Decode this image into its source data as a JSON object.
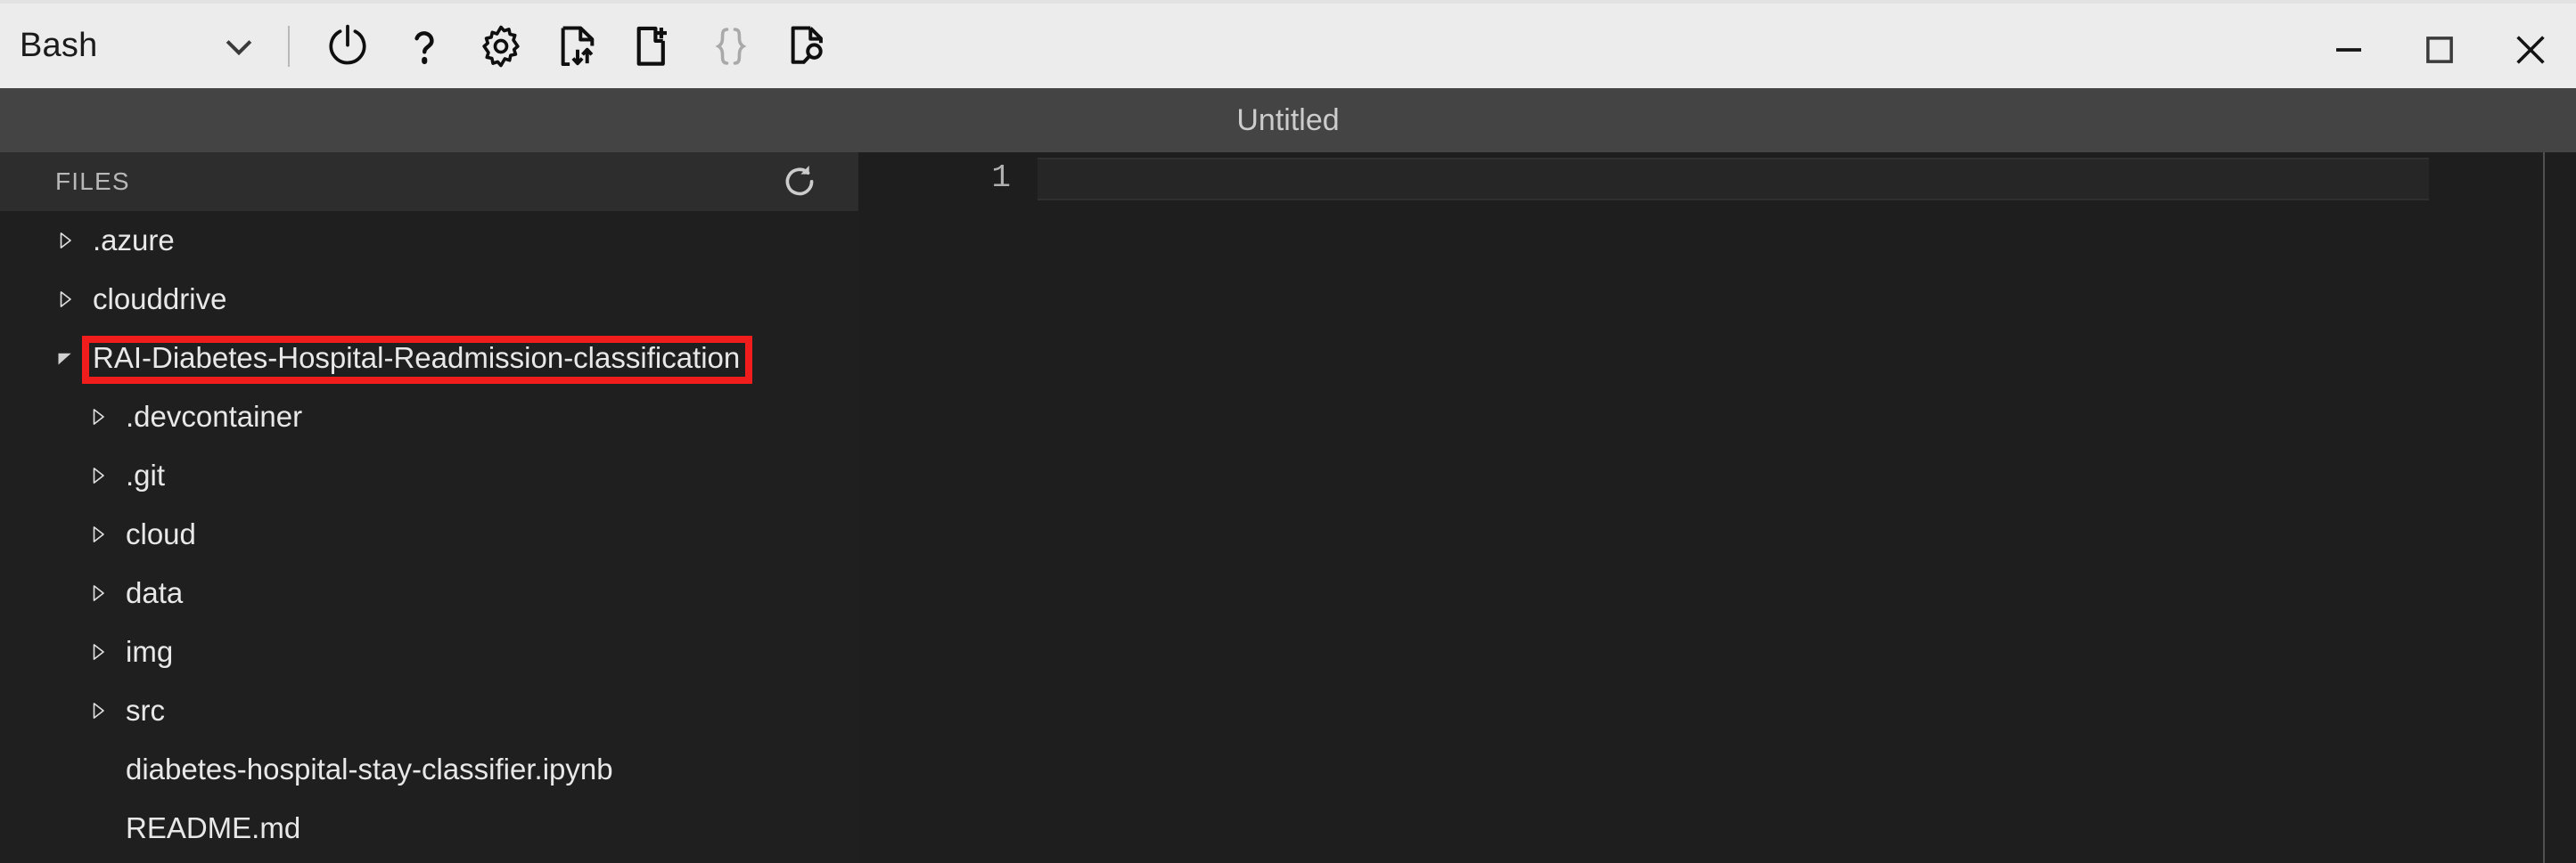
{
  "window": {
    "shell": {
      "name": "Bash",
      "chevron_icon": "chevron-down-icon"
    },
    "toolbar_buttons": [
      {
        "name": "power-icon",
        "label": "Restart"
      },
      {
        "name": "help-question-icon",
        "label": "Help"
      },
      {
        "name": "gear-icon",
        "label": "Settings"
      },
      {
        "name": "upload-download-file-icon",
        "label": "Upload/Download files"
      },
      {
        "name": "new-file-icon",
        "label": "New file"
      },
      {
        "name": "braces-icon",
        "label": "Editor actions"
      },
      {
        "name": "file-search-icon",
        "label": "Open file"
      }
    ],
    "controls": [
      {
        "name": "minimize-button",
        "label": "Minimize"
      },
      {
        "name": "maximize-button",
        "label": "Maximize"
      },
      {
        "name": "close-button",
        "label": "Close"
      }
    ]
  },
  "title_bar": {
    "title": "Untitled"
  },
  "sidebar": {
    "header": {
      "label": "FILES",
      "refresh_icon": "refresh-icon"
    },
    "tree": [
      {
        "label": ".azure",
        "depth": 0,
        "expanded": false,
        "type": "folder"
      },
      {
        "label": "clouddrive",
        "depth": 0,
        "expanded": false,
        "type": "folder"
      },
      {
        "label": "RAI-Diabetes-Hospital-Readmission-classification",
        "depth": 0,
        "expanded": true,
        "type": "folder",
        "highlighted": true
      },
      {
        "label": ".devcontainer",
        "depth": 1,
        "expanded": false,
        "type": "folder"
      },
      {
        "label": ".git",
        "depth": 1,
        "expanded": false,
        "type": "folder"
      },
      {
        "label": "cloud",
        "depth": 1,
        "expanded": false,
        "type": "folder"
      },
      {
        "label": "data",
        "depth": 1,
        "expanded": false,
        "type": "folder"
      },
      {
        "label": "img",
        "depth": 1,
        "expanded": false,
        "type": "folder"
      },
      {
        "label": "src",
        "depth": 1,
        "expanded": false,
        "type": "folder"
      },
      {
        "label": "diabetes-hospital-stay-classifier.ipynb",
        "depth": 1,
        "expanded": null,
        "type": "file"
      },
      {
        "label": "README.md",
        "depth": 1,
        "expanded": null,
        "type": "file"
      }
    ]
  },
  "editor": {
    "line_numbers": [
      "1"
    ],
    "content": ""
  },
  "colors": {
    "toolbar_bg": "#ececec",
    "title_bar_bg": "#444444",
    "sidebar_bg": "#1f1f1f",
    "sidebar_header_bg": "#2d2d2d",
    "editor_bg": "#1e1e1e",
    "highlight_annotation": "#f11d1d",
    "text_light": "#e8e8e8"
  }
}
